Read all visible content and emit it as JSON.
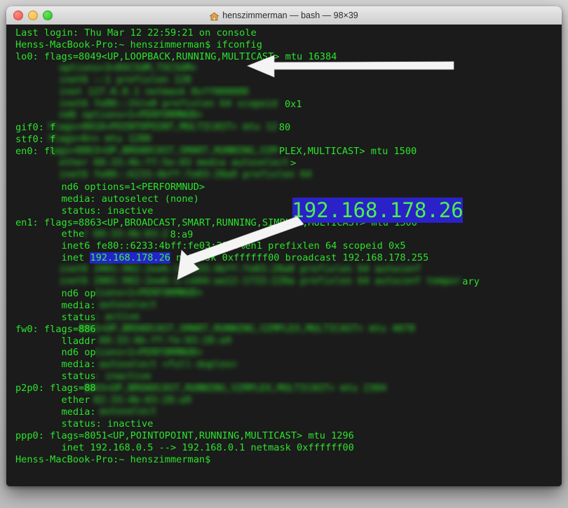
{
  "window": {
    "title": "henszimmerman — bash — 98×39",
    "icon": "home-icon",
    "controls": {
      "close": "close",
      "minimize": "minimize",
      "maximize": "maximize"
    }
  },
  "colors": {
    "terminal_background": "#1b1b1b",
    "terminal_text": "#2be32b",
    "selection_background": "#2323cc",
    "selection_text": "#3cf03c",
    "callout_background": "#2a22c8",
    "callout_text": "#4cf04c",
    "arrow": "#f2f2f2",
    "titlebar": "#dcdcdc",
    "light_close": "#f0534a",
    "light_minimize": "#f2b63c",
    "light_maximize": "#1fc51f"
  },
  "callout": {
    "enlarged_ip": "192.168.178.26"
  },
  "terminal": {
    "prompt": "Henss-MacBook-Pro:~ henszimmerman$",
    "command": "ifconfig",
    "selected_ip": "192.168.178.26",
    "lines": [
      {
        "text": "Last login: Thu Mar 12 22:59:21 on console"
      },
      {
        "text": "Henss-MacBook-Pro:~ henszimmerman$ ifconfig"
      },
      {
        "text": "lo0: flags=8049<UP,LOOPBACK,RUNNING,MULTICAST> mtu 16384"
      },
      {
        "text": "        options=3<RXCSUM,TXCSUM>",
        "blur": true
      },
      {
        "text": "        inet6 ::1 prefixlen 128",
        "blur": true
      },
      {
        "text": "        inet 127.0.0.1 netmask 0xff000000",
        "blur": true
      },
      {
        "text": "        inet6 fe80::1%lo0 prefixlen 64 scopeid 0x1",
        "blur": true,
        "tail": "0x1"
      },
      {
        "text": "        nd6 options=1<PERFORMNUD>",
        "blur": true
      },
      {
        "text": "gif0: flags=8010<POINTOPOINT,MULTICAST> mtu 1280",
        "blur_from": 5,
        "head": "gif0: f",
        "tail": "80"
      },
      {
        "text": "stf0: flags=0<> mtu 1280",
        "blur_from": 5,
        "head": "stf0: f"
      },
      {
        "text": "en0: flags=8863<UP,BROADCAST,SMART,RUNNING,SIMPLEX,MULTICAST> mtu 1500",
        "blur_from": 6,
        "head": "en0: fl",
        "tail": "PLEX,MULTICAST> mtu 1500"
      },
      {
        "text": "        ether 60:33:4b:ff:5e:03 media autoselect>",
        "blur": true,
        "tail": ">"
      },
      {
        "text": "        inet6 fe80::6233:4bff:fe03:28a9 prefixlen 64",
        "blur": true
      },
      {
        "text": "        nd6 options=1<PERFORMNUD>"
      },
      {
        "text": "        media: autoselect (none)"
      },
      {
        "text": "        status: inactive"
      },
      {
        "text": "en1: flags=8863<UP,BROADCAST,SMART,RUNNING,SIMPLEX,MULTICAST> mtu 1500"
      },
      {
        "text": "        ether 60:33:4b:03:28:a9",
        "blur_partial": true,
        "head": "        ethe",
        "tail": "8:a9"
      },
      {
        "text": "        inet6 fe80::6233:4bff:fe03:28a9%en1 prefixlen 64 scopeid 0x5"
      },
      {
        "text": "        inet 192.168.178.26 netmask 0xffffff00 broadcast 192.168.178.255"
      },
      {
        "text": "        inet6 2001:982:2ee6:1:6233:4bff:fe03:28a0 prefixlen 64 autoconf",
        "blur": true
      },
      {
        "text": "        inet6 2001:982:2ee6:1:cd44:aa12:1f33:220a prefixlen 64 autoconf temporary",
        "blur": true,
        "tail": "ary"
      },
      {
        "text": "        nd6 options=1<PERFORMNUD>",
        "blur_partial": true,
        "head": "        nd6 op"
      },
      {
        "text": "        media: autoselect",
        "blur_partial": true,
        "head": "        media:"
      },
      {
        "text": "        status: active",
        "blur_partial": true,
        "head": "        status"
      },
      {
        "text": "fw0: flags=8863<UP,BROADCAST,SMART,RUNNING,SIMPLEX,MULTICAST> mtu 4078",
        "blur_from": 11,
        "head": "fw0: flags=886"
      },
      {
        "text": "        lladdr 60:33:4b:ff:fe:03:28:a9",
        "blur_partial": true,
        "head": "        lladdr"
      },
      {
        "text": "        nd6 options=1<PERFORMNUD>",
        "blur_partial": true,
        "head": "        nd6 op"
      },
      {
        "text": "        media: autoselect <full-duplex>",
        "blur_partial": true,
        "head": "        media:"
      },
      {
        "text": "        status: inactive",
        "blur_partial": true,
        "head": "        status"
      },
      {
        "text": "p2p0: flags=8843<UP,BROADCAST,RUNNING,SIMPLEX,MULTICAST> mtu 2304",
        "blur_from": 12,
        "head": "p2p0: flags=88"
      },
      {
        "text": "        ether 02:33:4b:03:28:a9",
        "blur_partial": true,
        "head": "        ether"
      },
      {
        "text": "        media: autoselect",
        "blur_partial": true,
        "head": "        media:"
      },
      {
        "text": "        status: inactive"
      },
      {
        "text": "ppp0: flags=8051<UP,POINTOPOINT,RUNNING,MULTICAST> mtu 1296"
      },
      {
        "text": "        inet 192.168.0.5 --> 192.168.0.1 netmask 0xffffff00"
      },
      {
        "text": "Henss-MacBook-Pro:~ henszimmerman$"
      }
    ]
  }
}
